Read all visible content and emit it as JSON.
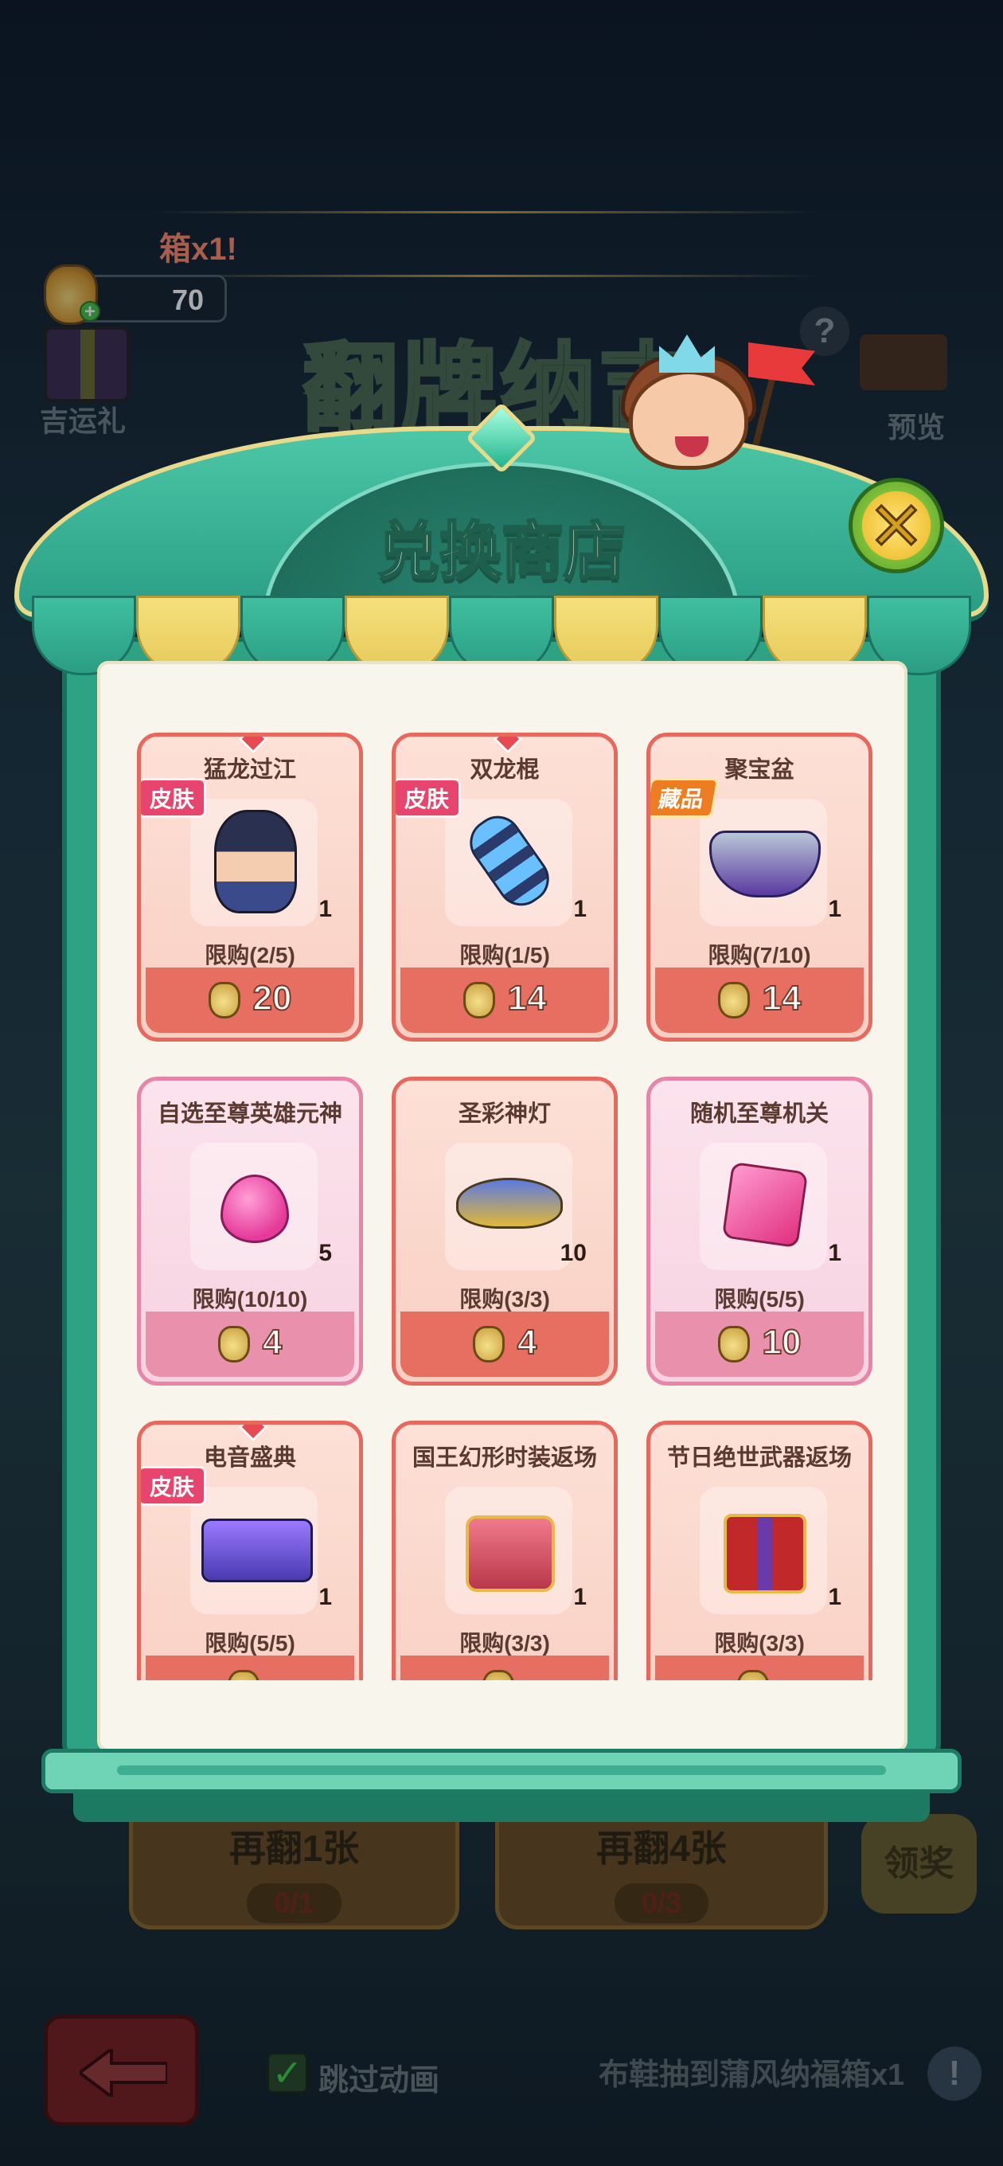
{
  "background": {
    "banner_text": "箱x1!",
    "coin_count": "70",
    "lucky_gift_label": "吉运礼",
    "game_title": "翻牌纳吉",
    "preview_label": "预览",
    "help_icon": "?",
    "flip_one": {
      "label": "再翻1张",
      "counter": "0/1"
    },
    "flip_four": {
      "label": "再翻4张",
      "counter": "0/3"
    },
    "claim_label": "领奖",
    "skip_animation_label": "跳过动画",
    "bottom_message": "布鞋抽到蒲风纳福箱x1",
    "info_icon": "!"
  },
  "shop": {
    "title": "兑换商店",
    "close_icon": "✕",
    "items": [
      {
        "name": "猛龙过江",
        "badge": "皮肤",
        "quantity": "1",
        "limit": "限购(2/5)",
        "price": "20",
        "style": "red",
        "art": "hero",
        "diamond": true
      },
      {
        "name": "双龙棍",
        "badge": "皮肤",
        "quantity": "1",
        "limit": "限购(1/5)",
        "price": "14",
        "style": "red",
        "art": "nun",
        "diamond": true
      },
      {
        "name": "聚宝盆",
        "badge": "藏品",
        "quantity": "1",
        "limit": "限购(7/10)",
        "price": "14",
        "style": "red",
        "art": "bowl",
        "diamond": false
      },
      {
        "name": "自选至尊英雄元神",
        "badge": "",
        "quantity": "5",
        "limit": "限购(10/10)",
        "price": "4",
        "style": "pink",
        "art": "orb",
        "diamond": false
      },
      {
        "name": "圣彩神灯",
        "badge": "",
        "quantity": "10",
        "limit": "限购(3/3)",
        "price": "4",
        "style": "red",
        "art": "lamp",
        "diamond": false
      },
      {
        "name": "随机至尊机关",
        "badge": "",
        "quantity": "1",
        "limit": "限购(5/5)",
        "price": "10",
        "style": "pink",
        "art": "cube",
        "diamond": false
      },
      {
        "name": "电音盛典",
        "badge": "皮肤",
        "quantity": "1",
        "limit": "限购(5/5)",
        "price": "",
        "style": "red",
        "art": "dj",
        "diamond": true
      },
      {
        "name": "国王幻形时装返场",
        "badge": "",
        "quantity": "1",
        "limit": "限购(3/3)",
        "price": "",
        "style": "red",
        "art": "chest",
        "diamond": false
      },
      {
        "name": "节日绝世武器返场",
        "badge": "",
        "quantity": "1",
        "limit": "限购(3/3)",
        "price": "",
        "style": "red",
        "art": "gift",
        "diamond": false
      }
    ]
  },
  "colors": {
    "shop_green": "#2da383",
    "awning_yellow": "#f4e07c",
    "card_red_border": "#e86860",
    "card_pink_border": "#e784a8",
    "skin_badge": "#e8456e",
    "collect_badge": "#ee7c20"
  }
}
